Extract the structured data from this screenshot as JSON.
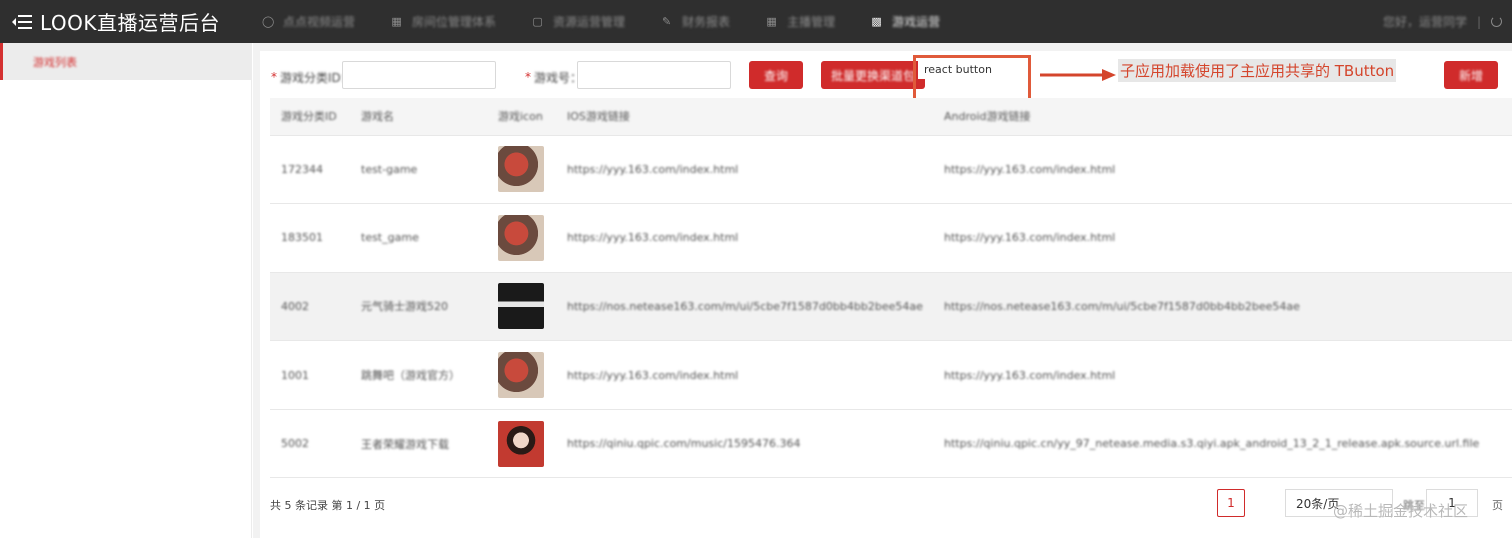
{
  "header": {
    "title": "LOOK直播运营后台",
    "nav": [
      {
        "label": "点点视频运营",
        "icon": "shield-icon",
        "active": false
      },
      {
        "label": "房间位管理体系",
        "icon": "grid-icon",
        "active": false
      },
      {
        "label": "资源运营管理",
        "icon": "chart-icon",
        "active": false
      },
      {
        "label": "财务报表",
        "icon": "edit-icon",
        "active": false
      },
      {
        "label": "主播管理",
        "icon": "grid-icon",
        "active": false
      },
      {
        "label": "游戏运营",
        "icon": "apps-icon",
        "active": true
      }
    ],
    "user": {
      "greeting": "您好，运营同学",
      "separator": "|"
    }
  },
  "sidebar": {
    "items": [
      {
        "label": "游戏列表",
        "active": true
      }
    ]
  },
  "filters": {
    "field1": {
      "label": "游戏分类ID：",
      "value": ""
    },
    "field2": {
      "label": "游戏号：",
      "value": ""
    },
    "query_label": "查询",
    "batch_label": "批量更换渠道包",
    "react_button_label": "react button",
    "add_label": "新增"
  },
  "annotation": {
    "text": "子应用加载使用了主应用共享的 TButton",
    "color": "#d4452c"
  },
  "table": {
    "columns": [
      "游戏分类ID",
      "游戏名",
      "游戏icon",
      "IOS游戏链接",
      "Android游戏链接"
    ],
    "rows": [
      {
        "id": "172344",
        "name": "test-game",
        "icon": "t1",
        "ios": "https://yyy.163.com/index.html",
        "android": "https://yyy.163.com/index.html",
        "highlighted": false
      },
      {
        "id": "183501",
        "name": "test_game",
        "icon": "t1",
        "ios": "https://yyy.163.com/index.html",
        "android": "https://yyy.163.com/index.html",
        "highlighted": false
      },
      {
        "id": "4002",
        "name": "元气骑士游戏520",
        "icon": "t2",
        "ios": "https://nos.netease163.com/m/ui/5cbe7f1587d0bb4bb2bee54ae",
        "android": "https://nos.netease163.com/m/ui/5cbe7f1587d0bb4bb2bee54ae",
        "highlighted": true
      },
      {
        "id": "1001",
        "name": "跳舞吧（游戏官方）",
        "icon": "t1",
        "ios": "https://yyy.163.com/index.html",
        "android": "https://yyy.163.com/index.html",
        "highlighted": false
      },
      {
        "id": "5002",
        "name": "王者荣耀游戏下载",
        "icon": "t3",
        "ios": "https://qiniu.qpic.com/music/1595476.364",
        "android": "https://qiniu.qpic.cn/yy_97_netease.media.s3.qiyi.apk_android_13_2_1_release.apk.source.url.file",
        "highlighted": false
      }
    ]
  },
  "pagination": {
    "total_text": "共 5 条记录 第 1 / 1 页",
    "current_page": "1",
    "page_size": "20条/页",
    "goto_label": "跳至",
    "goto_value": "1",
    "goto_unit": "页"
  },
  "watermark": "@稀土掘金技术社区"
}
